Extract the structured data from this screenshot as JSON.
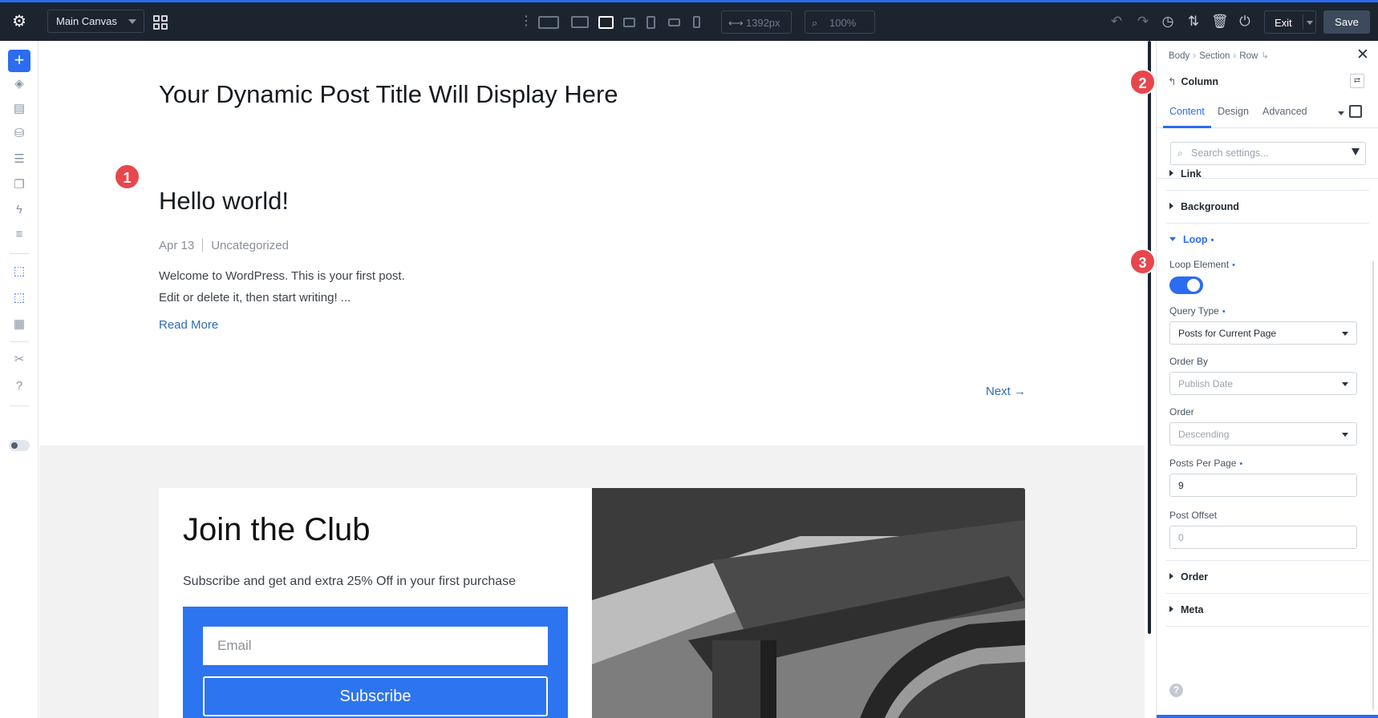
{
  "toolbar": {
    "canvas_select": "Main Canvas",
    "width_value": "1392px",
    "zoom_value": "100%",
    "exit_label": "Exit",
    "save_label": "Save",
    "accent": "#2b6cf0"
  },
  "canvas": {
    "post_title": "Your Dynamic Post Title Will Display Here",
    "post": {
      "title": "Hello world!",
      "date": "Apr 13",
      "category": "Uncategorized",
      "excerpt": "Welcome to WordPress. This is your first post. Edit or delete it, then start writing! ...",
      "read_more": "Read More"
    },
    "next_link": "Next →",
    "club": {
      "title": "Join the Club",
      "subtitle": "Subscribe and get and extra 25% Off in your first purchase",
      "email_placeholder": "Email",
      "subscribe_label": "Subscribe"
    }
  },
  "badges": [
    "1",
    "2",
    "3"
  ],
  "panel": {
    "breadcrumb": [
      "Body",
      "Section",
      "Row"
    ],
    "element": "Column",
    "tabs": [
      "Content",
      "Design",
      "Advanced"
    ],
    "search_placeholder": "Search settings...",
    "groups": {
      "link": "Link",
      "background": "Background",
      "loop": "Loop",
      "order": "Order",
      "meta": "Meta"
    },
    "loop": {
      "loop_element_label": "Loop Element",
      "loop_element_on": true,
      "query_type_label": "Query Type",
      "query_type_value": "Posts for Current Page",
      "order_by_label": "Order By",
      "order_by_value": "Publish Date",
      "order_label": "Order",
      "order_value": "Descending",
      "posts_per_page_label": "Posts Per Page",
      "posts_per_page_value": "9",
      "post_offset_label": "Post Offset",
      "post_offset_value": "0"
    },
    "help": "?"
  }
}
